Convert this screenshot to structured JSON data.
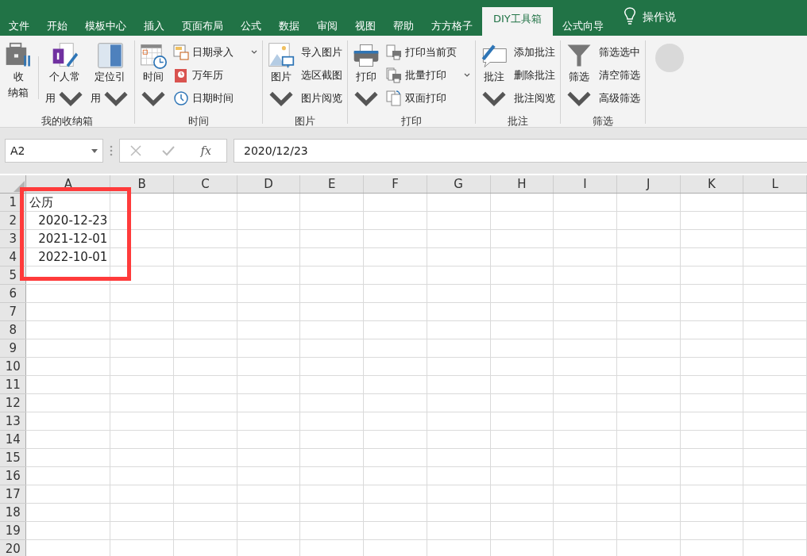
{
  "tabs": [
    {
      "label": "文件",
      "selected": false
    },
    {
      "label": "开始",
      "selected": false
    },
    {
      "label": "模板中心",
      "selected": false
    },
    {
      "label": "插入",
      "selected": false
    },
    {
      "label": "页面布局",
      "selected": false
    },
    {
      "label": "公式",
      "selected": false
    },
    {
      "label": "数据",
      "selected": false
    },
    {
      "label": "审阅",
      "selected": false
    },
    {
      "label": "视图",
      "selected": false
    },
    {
      "label": "帮助",
      "selected": false
    },
    {
      "label": "方方格子",
      "selected": false
    },
    {
      "label": "DIY工具箱",
      "selected": true
    },
    {
      "label": "公式向导",
      "selected": false
    }
  ],
  "tell_me": {
    "label": "操作说"
  },
  "ribbon": {
    "groups": [
      {
        "label": "我的收纳箱",
        "large": [
          {
            "lines": [
              "收",
              "纳箱"
            ],
            "dropdown": false
          },
          {
            "lines": [
              "个人常",
              "用"
            ],
            "dropdown": true
          },
          {
            "lines": [
              "定位引",
              "用"
            ],
            "dropdown": true
          }
        ]
      },
      {
        "label": "时间",
        "large": [
          {
            "lines": [
              "时间"
            ],
            "dropdown": true
          }
        ],
        "small": [
          {
            "label": "日期录入",
            "dropdown": true
          },
          {
            "label": "万年历",
            "dropdown": false
          },
          {
            "label": "日期时间",
            "dropdown": false
          }
        ]
      },
      {
        "label": "图片",
        "large": [
          {
            "lines": [
              "图片"
            ],
            "dropdown": true
          }
        ],
        "small": [
          {
            "label": "导入图片",
            "dropdown": false
          },
          {
            "label": "选区截图",
            "dropdown": false
          },
          {
            "label": "图片阅览",
            "dropdown": false
          }
        ]
      },
      {
        "label": "打印",
        "large": [
          {
            "lines": [
              "打印"
            ],
            "dropdown": true
          }
        ],
        "small": [
          {
            "label": "打印当前页",
            "dropdown": false
          },
          {
            "label": "批量打印",
            "dropdown": true
          },
          {
            "label": "双面打印",
            "dropdown": false
          }
        ]
      },
      {
        "label": "批注",
        "large": [
          {
            "lines": [
              "批注"
            ],
            "dropdown": true
          }
        ],
        "small": [
          {
            "label": "添加批注",
            "dropdown": false
          },
          {
            "label": "删除批注",
            "dropdown": false
          },
          {
            "label": "批注阅览",
            "dropdown": false
          }
        ]
      },
      {
        "label": "筛选",
        "large": [
          {
            "lines": [
              "筛选"
            ],
            "dropdown": true
          }
        ],
        "small": [
          {
            "label": "筛选选中",
            "dropdown": false
          },
          {
            "label": "清空筛选",
            "dropdown": false
          },
          {
            "label": "高级筛选",
            "dropdown": false
          }
        ]
      }
    ]
  },
  "formula_bar": {
    "name_box": "A2",
    "fx": "fx",
    "value": "2020/12/23"
  },
  "grid": {
    "columns": [
      "A",
      "B",
      "C",
      "D",
      "E",
      "F",
      "G",
      "H",
      "I",
      "J",
      "K",
      "L"
    ],
    "highlight_box": true,
    "rows": [
      {
        "header": "1",
        "cells": [
          {
            "text": "公历",
            "kind": "text"
          }
        ]
      },
      {
        "header": "2",
        "cells": [
          {
            "text": "2020-12-23",
            "kind": "date"
          }
        ]
      },
      {
        "header": "3",
        "cells": [
          {
            "text": "2021-12-01",
            "kind": "date"
          }
        ]
      },
      {
        "header": "4",
        "cells": [
          {
            "text": "2022-10-01",
            "kind": "date"
          }
        ]
      },
      {
        "header": "5",
        "cells": []
      },
      {
        "header": "6",
        "cells": []
      },
      {
        "header": "7",
        "cells": []
      },
      {
        "header": "8",
        "cells": []
      },
      {
        "header": "9",
        "cells": []
      },
      {
        "header": "10",
        "cells": []
      },
      {
        "header": "11",
        "cells": []
      },
      {
        "header": "12",
        "cells": []
      },
      {
        "header": "13",
        "cells": []
      },
      {
        "header": "14",
        "cells": []
      },
      {
        "header": "15",
        "cells": []
      },
      {
        "header": "16",
        "cells": []
      },
      {
        "header": "17",
        "cells": []
      },
      {
        "header": "18",
        "cells": []
      },
      {
        "header": "19",
        "cells": []
      },
      {
        "header": "20",
        "cells": []
      }
    ]
  }
}
